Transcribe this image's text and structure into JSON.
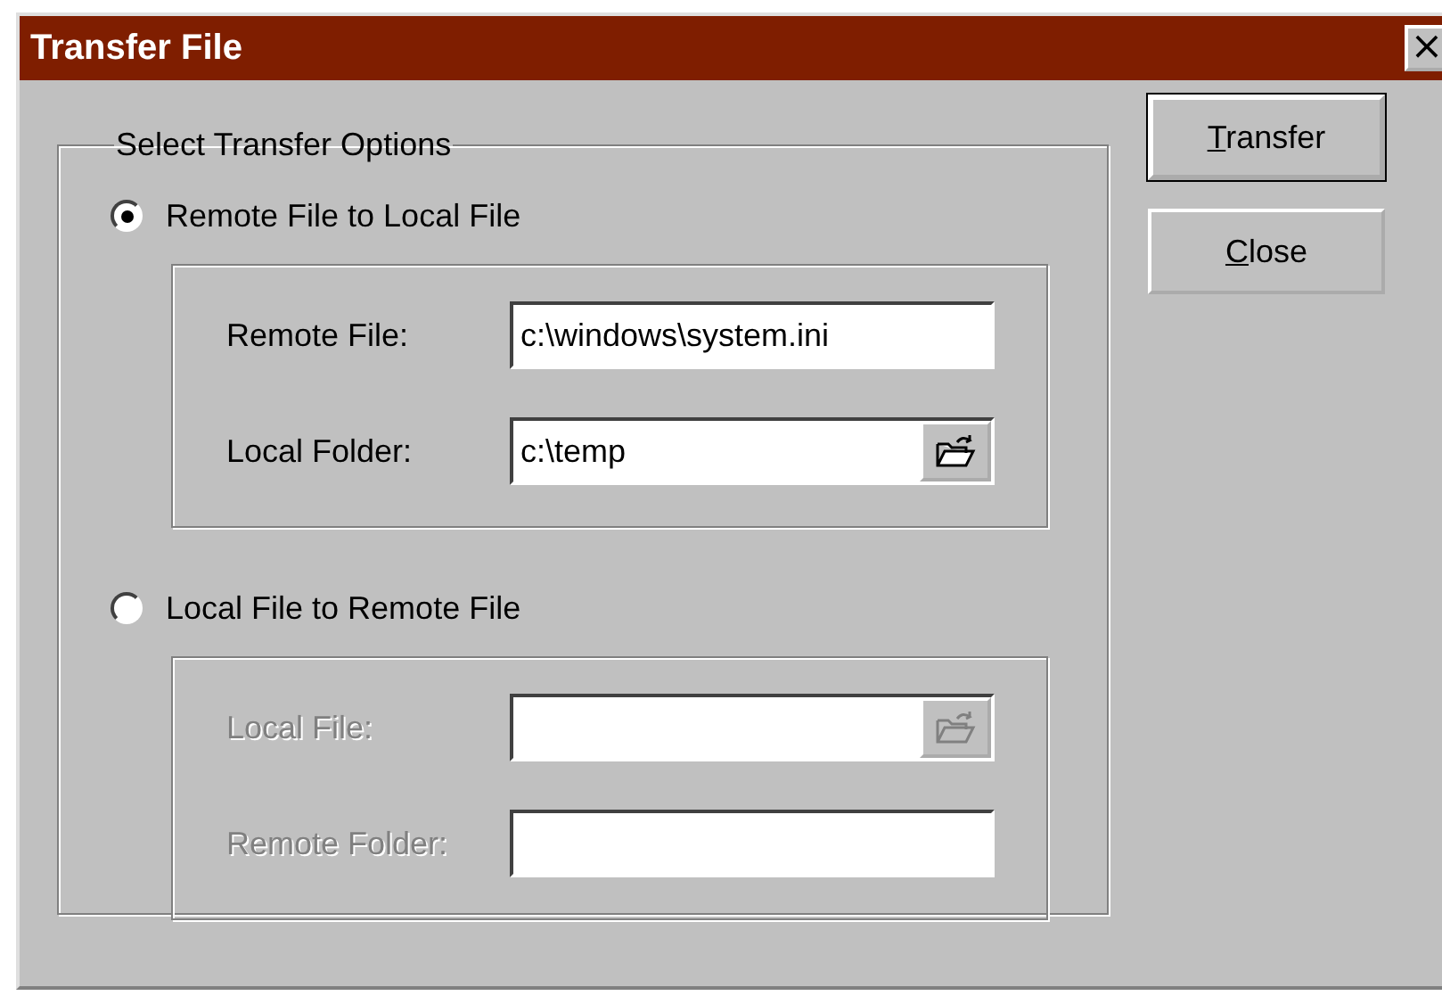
{
  "window": {
    "title": "Transfer File",
    "close_label": "×"
  },
  "options": {
    "legend": "Select Transfer Options",
    "choices": [
      {
        "label": "Remote File to Local File",
        "selected": true,
        "disabled": false,
        "fields": [
          {
            "label": "Remote File:",
            "value": "c:\\windows\\system.ini",
            "kind": "text"
          },
          {
            "label": "Local Folder:",
            "value": "c:\\temp",
            "kind": "browse"
          }
        ]
      },
      {
        "label": "Local File to Remote File",
        "selected": false,
        "disabled": true,
        "fields": [
          {
            "label": "Local File:",
            "kind": "browse"
          },
          {
            "label": "Remote Folder:",
            "kind": "text"
          }
        ]
      }
    ]
  },
  "buttons": [
    {
      "label": "Transfer",
      "default": true
    },
    {
      "label": "Close",
      "default": false
    }
  ]
}
